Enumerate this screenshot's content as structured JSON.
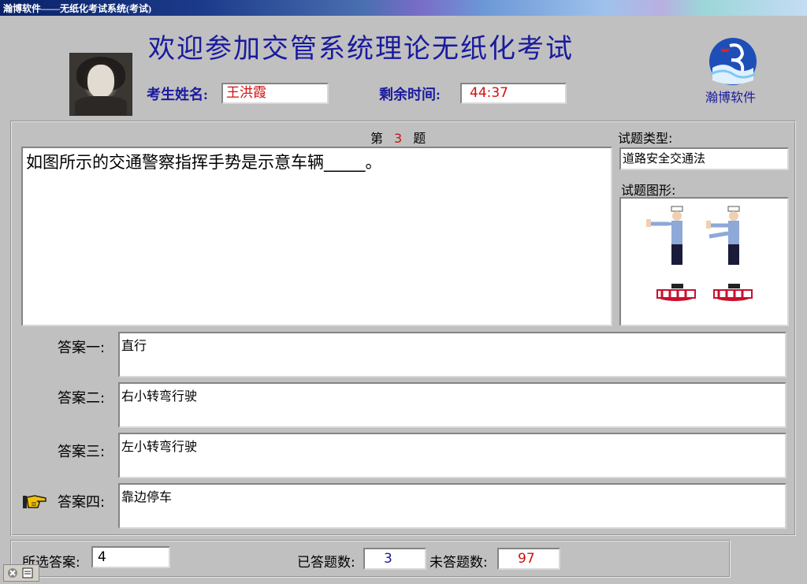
{
  "window": {
    "title": "瀚博软件——无纸化考试系统(考试)"
  },
  "header": {
    "main_title": "欢迎参加交管系统理论无纸化考试",
    "name_label": "考生姓名:",
    "name_value": "王洪霞",
    "time_label": "剩余时间:",
    "time_value": "44:37",
    "logo_text": "瀚博软件"
  },
  "question": {
    "prefix": "第",
    "number": "3",
    "suffix": "题",
    "text": "如图所示的交通警察指挥手势是示意车辆_____。",
    "type_label": "试题类型:",
    "type_value": "道路安全交通法",
    "image_label": "试题图形:"
  },
  "answers": [
    {
      "label": "答案一:",
      "text": "直行"
    },
    {
      "label": "答案二:",
      "text": "右小转弯行驶"
    },
    {
      "label": "答案三:",
      "text": "左小转弯行驶"
    },
    {
      "label": "答案四:",
      "text": "靠边停车"
    }
  ],
  "footer": {
    "selected_label": "所选答案:",
    "selected_value": "4",
    "answered_label": "已答题数:",
    "answered_value": "3",
    "unanswered_label": "未答题数:",
    "unanswered_value": "97"
  },
  "colors": {
    "title_blue": "#1a1a9e",
    "value_red": "#d01010",
    "bg": "#c0c0c0"
  }
}
